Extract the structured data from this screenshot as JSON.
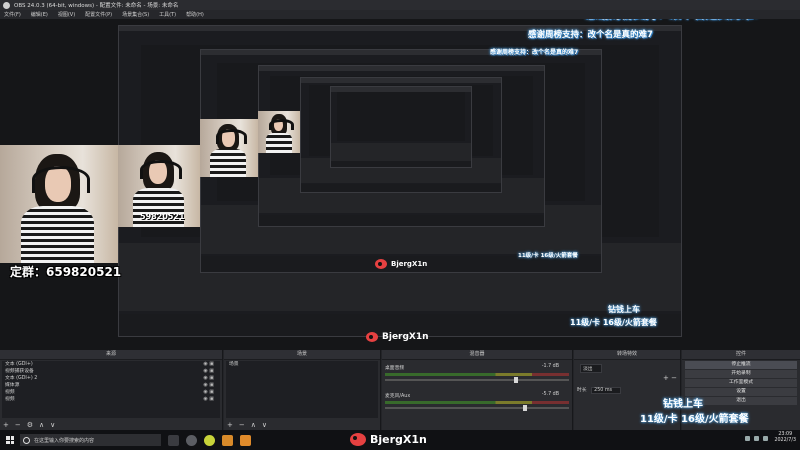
{
  "window": {
    "title": "OBS 24.0.3 (64-bit, windows) - 配置文件: 未命名 - 场景: 未命名"
  },
  "menu": [
    "文件(F)",
    "编辑(E)",
    "视图(V)",
    "配置文件(P)",
    "场景集合(S)",
    "工具(T)",
    "帮助(H)"
  ],
  "overlay": {
    "thanks": "感谢周榜支持：改个名是真的难7",
    "qq_group": "定群：659820521",
    "qq_group_partial": "59820521",
    "weibo": "BjergX1n",
    "rocket_top": "钻钱上车",
    "rocket_bottom": "11级/卡 16级/火箭套餐"
  },
  "docks": {
    "scenes": {
      "title": "场景",
      "items": [
        "场景"
      ]
    },
    "sources": {
      "title": "来源",
      "items": [
        "文本 (GDI+)",
        "视频捕获设备",
        "文本 (GDI+) 2",
        "媒体源",
        "视频",
        "视频"
      ]
    },
    "mixer": {
      "title": "混音器",
      "channels": [
        {
          "name": "桌面音频",
          "db": "-1.7 dB"
        },
        {
          "name": "麦克风/Aux",
          "db": "-5.7 dB"
        }
      ]
    },
    "transitions": {
      "title": "转场特效",
      "type": "淡出",
      "duration_label": "时长",
      "duration": "250 ms"
    },
    "controls": {
      "title": "控件",
      "buttons": [
        "停止推流",
        "开始录制",
        "工作室模式",
        "设置",
        "退出"
      ]
    }
  },
  "taskbar": {
    "search_placeholder": "在这里输入你要搜索的内容",
    "time": "23:09",
    "date": "2022/7/3"
  }
}
